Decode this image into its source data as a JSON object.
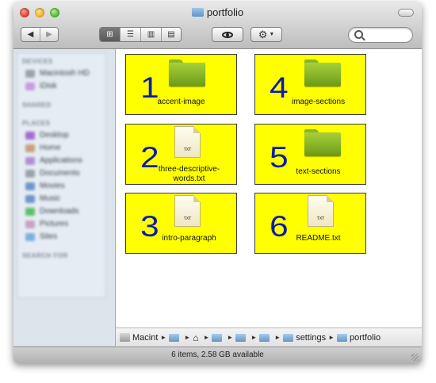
{
  "window": {
    "title": "portfolio"
  },
  "toolbar": {
    "back_icon": "chevron-left-icon",
    "forward_icon": "chevron-right-icon",
    "view_modes": [
      "icon-view-icon",
      "list-view-icon",
      "column-view-icon",
      "cover-flow-icon"
    ],
    "active_view": "icon-view-icon",
    "quick_look_icon": "eye-icon",
    "action_icon": "gear-icon",
    "search": {
      "value": "",
      "placeholder": ""
    }
  },
  "items": [
    {
      "number": "1",
      "kind": "folder",
      "label_lines": [
        "accent-image"
      ]
    },
    {
      "number": "4",
      "kind": "folder",
      "label_lines": [
        "image-sections"
      ]
    },
    {
      "number": "2",
      "kind": "text-file",
      "badge": "TXT",
      "label_lines": [
        "three-descriptive-",
        "words.txt"
      ]
    },
    {
      "number": "5",
      "kind": "folder",
      "label_lines": [
        "text-sections"
      ]
    },
    {
      "number": "3",
      "kind": "text-file",
      "badge": "TXT",
      "label_lines": [
        "intro-paragraph"
      ]
    },
    {
      "number": "6",
      "kind": "text-file",
      "badge": "TXT",
      "label_lines": [
        "README.txt"
      ]
    }
  ],
  "pathbar": {
    "segments": [
      "Macint",
      "",
      "",
      "",
      "",
      "",
      "settings",
      "portfolio"
    ]
  },
  "status": {
    "text": "6 items, 2.58 GB available"
  },
  "colors": {
    "tile": "#ffff00",
    "number": "#0c1ea6",
    "folder": "#8fbf2a"
  }
}
